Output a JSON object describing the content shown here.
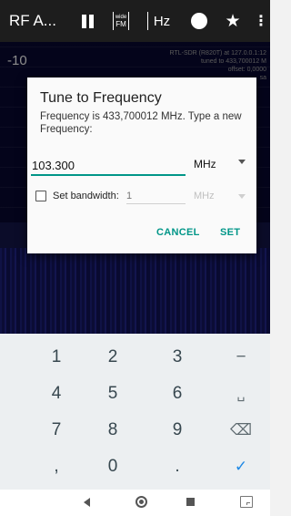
{
  "app": {
    "title": "RF A...",
    "toolbar": {
      "pause_icon": "pause-icon",
      "demod_icon_text_top": "wide",
      "demod_icon_text_bottom": "FM",
      "hz_label": "Hz",
      "record_icon": "record-icon",
      "bookmark_icon": "star-icon",
      "overflow_icon": "more-vert-icon"
    }
  },
  "spectrum": {
    "db_label": "-10",
    "source_info": [
      "RTL-SDR (R820T) at 127.0.0.1:12",
      "tuned to 433,700012 M",
      "offset: 0,0000",
      "sa"
    ],
    "accent_color": "#07072a"
  },
  "dialog": {
    "title": "Tune to Frequency",
    "message": "Frequency is 433,700012 MHz. Type a new Frequency:",
    "frequency_value": "103.300",
    "frequency_unit": "MHz",
    "bandwidth_label": "Set bandwidth:",
    "bandwidth_placeholder": "1",
    "bandwidth_unit": "MHz",
    "bandwidth_checked": false,
    "cancel_label": "CANCEL",
    "set_label": "SET",
    "accent_color": "#009688"
  },
  "keyboard": {
    "rows": [
      [
        "1",
        "2",
        "3",
        "−"
      ],
      [
        "4",
        "5",
        "6",
        "␣"
      ],
      [
        "7",
        "8",
        "9",
        "⌫"
      ],
      [
        ",",
        "0",
        ".",
        "✓"
      ]
    ]
  },
  "navbar": {
    "back_icon": "back-icon",
    "home_icon": "home-icon",
    "recents_icon": "recents-icon",
    "keyboard_icon": "keyboard-switch-icon"
  }
}
